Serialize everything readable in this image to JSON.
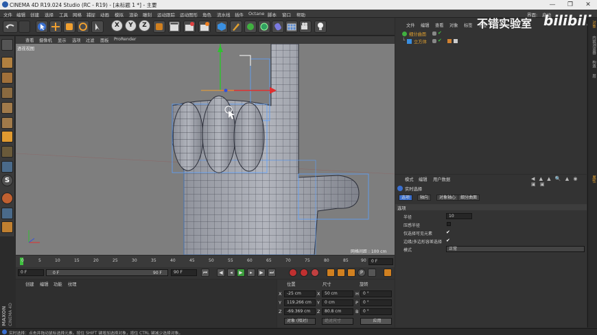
{
  "titlebar": {
    "title": "CINEMA 4D R19.024 Studio (RC - R19) - [未标题 1 *] - 主要",
    "minimize": "—",
    "maximize": "❐",
    "close": "✕"
  },
  "menubar": {
    "items": [
      "文件",
      "编辑",
      "创建",
      "选择",
      "工具",
      "网格",
      "捕捉",
      "动画",
      "模拟",
      "渲染",
      "雕刻",
      "运动跟踪",
      "运动图形",
      "角色",
      "流水线",
      "插件",
      "Octane",
      "脚本",
      "窗口",
      "帮助"
    ],
    "layout_label": "界面:",
    "layout_value": "启动"
  },
  "viewport": {
    "menu": [
      "查看",
      "摄像机",
      "显示",
      "选项",
      "过滤",
      "面板",
      "ProRender"
    ],
    "camera_label": "透视视图",
    "grid_spacing": "网格间距 : 100 cm"
  },
  "timeline": {
    "ticks": [
      "0",
      "5",
      "10",
      "15",
      "20",
      "25",
      "30",
      "35",
      "40",
      "45",
      "50",
      "55",
      "60",
      "65",
      "70",
      "75",
      "80",
      "85",
      "90"
    ],
    "current_frame": "0 F"
  },
  "transport": {
    "start": "0 F",
    "range_start": "0 F",
    "range_end": "90 F",
    "end": "90 F"
  },
  "materials": {
    "menu": [
      "创建",
      "编辑",
      "功能",
      "纹理"
    ]
  },
  "coords": {
    "headers": [
      "位置",
      "尺寸",
      "旋转"
    ],
    "rows": [
      {
        "axis": "X",
        "pos": "-25 cm",
        "size": "50 cm",
        "rot_axis": "H",
        "rot": "0 °"
      },
      {
        "axis": "Y",
        "pos": "119.266 cm",
        "size": "0 cm",
        "rot_axis": "P",
        "rot": "0 °"
      },
      {
        "axis": "Z",
        "pos": "-69.369 cm",
        "size": "80.8 cm",
        "rot_axis": "B",
        "rot": "0 °"
      }
    ],
    "mode": "对象 (相对)",
    "size_mode": "绝对尺寸",
    "apply": "应用"
  },
  "objects": {
    "menu": [
      "文件",
      "编辑",
      "查看",
      "对象",
      "标签",
      "书签"
    ],
    "items": [
      {
        "name": "细分曲面"
      },
      {
        "name": "立方体"
      }
    ]
  },
  "attributes": {
    "menu": [
      "模式",
      "编辑",
      "用户数据"
    ],
    "tool_name": "实时选择",
    "tabs": [
      "选项",
      "轴向",
      "对象轴心",
      "细分曲面"
    ],
    "section": "选项",
    "rows": [
      {
        "label": "半径",
        "value": "10"
      },
      {
        "label": "压感半径",
        "value": ""
      },
      {
        "label": "仅选择可见元素",
        "value": "✔"
      },
      {
        "label": "边缘/多边形容差选择",
        "value": "✔"
      },
      {
        "label": "模式",
        "value": "正常"
      }
    ]
  },
  "right_tabs": [
    "对象",
    "内容浏览器",
    "构造",
    "层",
    "属性"
  ],
  "status": "实时选择：点击并拖动鼠标选择元素。按住 SHIFT 键增加选择对象，按住 CTRL 键减少选择对象。",
  "maxon": {
    "brand": "MAXON",
    "product": "CINEMA 4D"
  },
  "watermark": {
    "text": "不错实验室",
    "logo": "bilibili"
  },
  "colors": {
    "accent": "#f0a030",
    "selection": "#5aa0ff",
    "axis_x": "#e03030",
    "axis_y": "#30c030",
    "axis_z": "#3050e0"
  }
}
